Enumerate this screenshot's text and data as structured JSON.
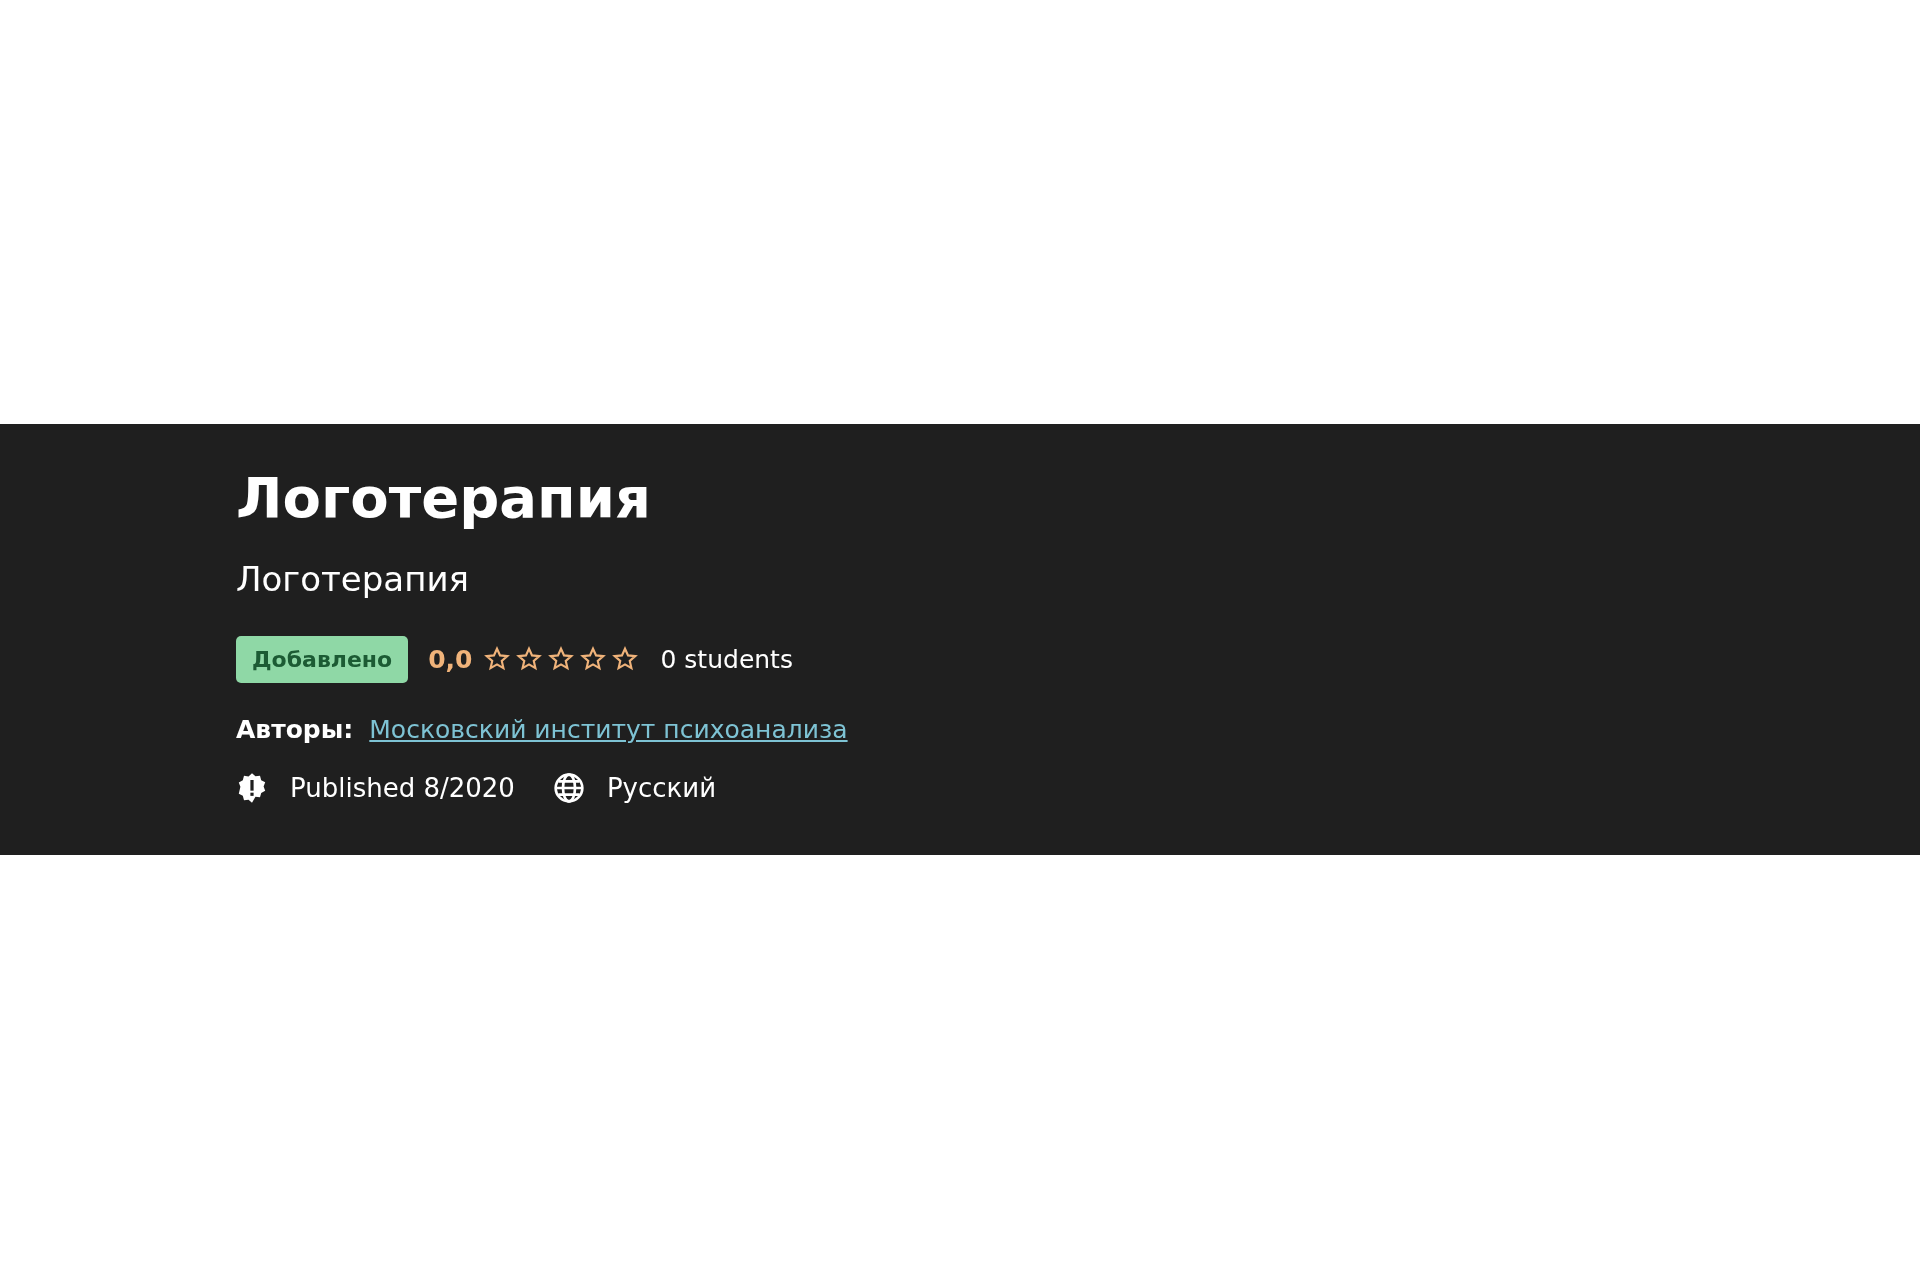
{
  "course": {
    "title": "Логотерапия",
    "subtitle": "Логотерапия",
    "badge": "Добавлено",
    "rating": "0,0",
    "stars": 0,
    "students": "0 students",
    "authors_label": "Авторы:",
    "author": "Московский институт психоанализа",
    "published": "Published 8/2020",
    "language": "Русский"
  }
}
